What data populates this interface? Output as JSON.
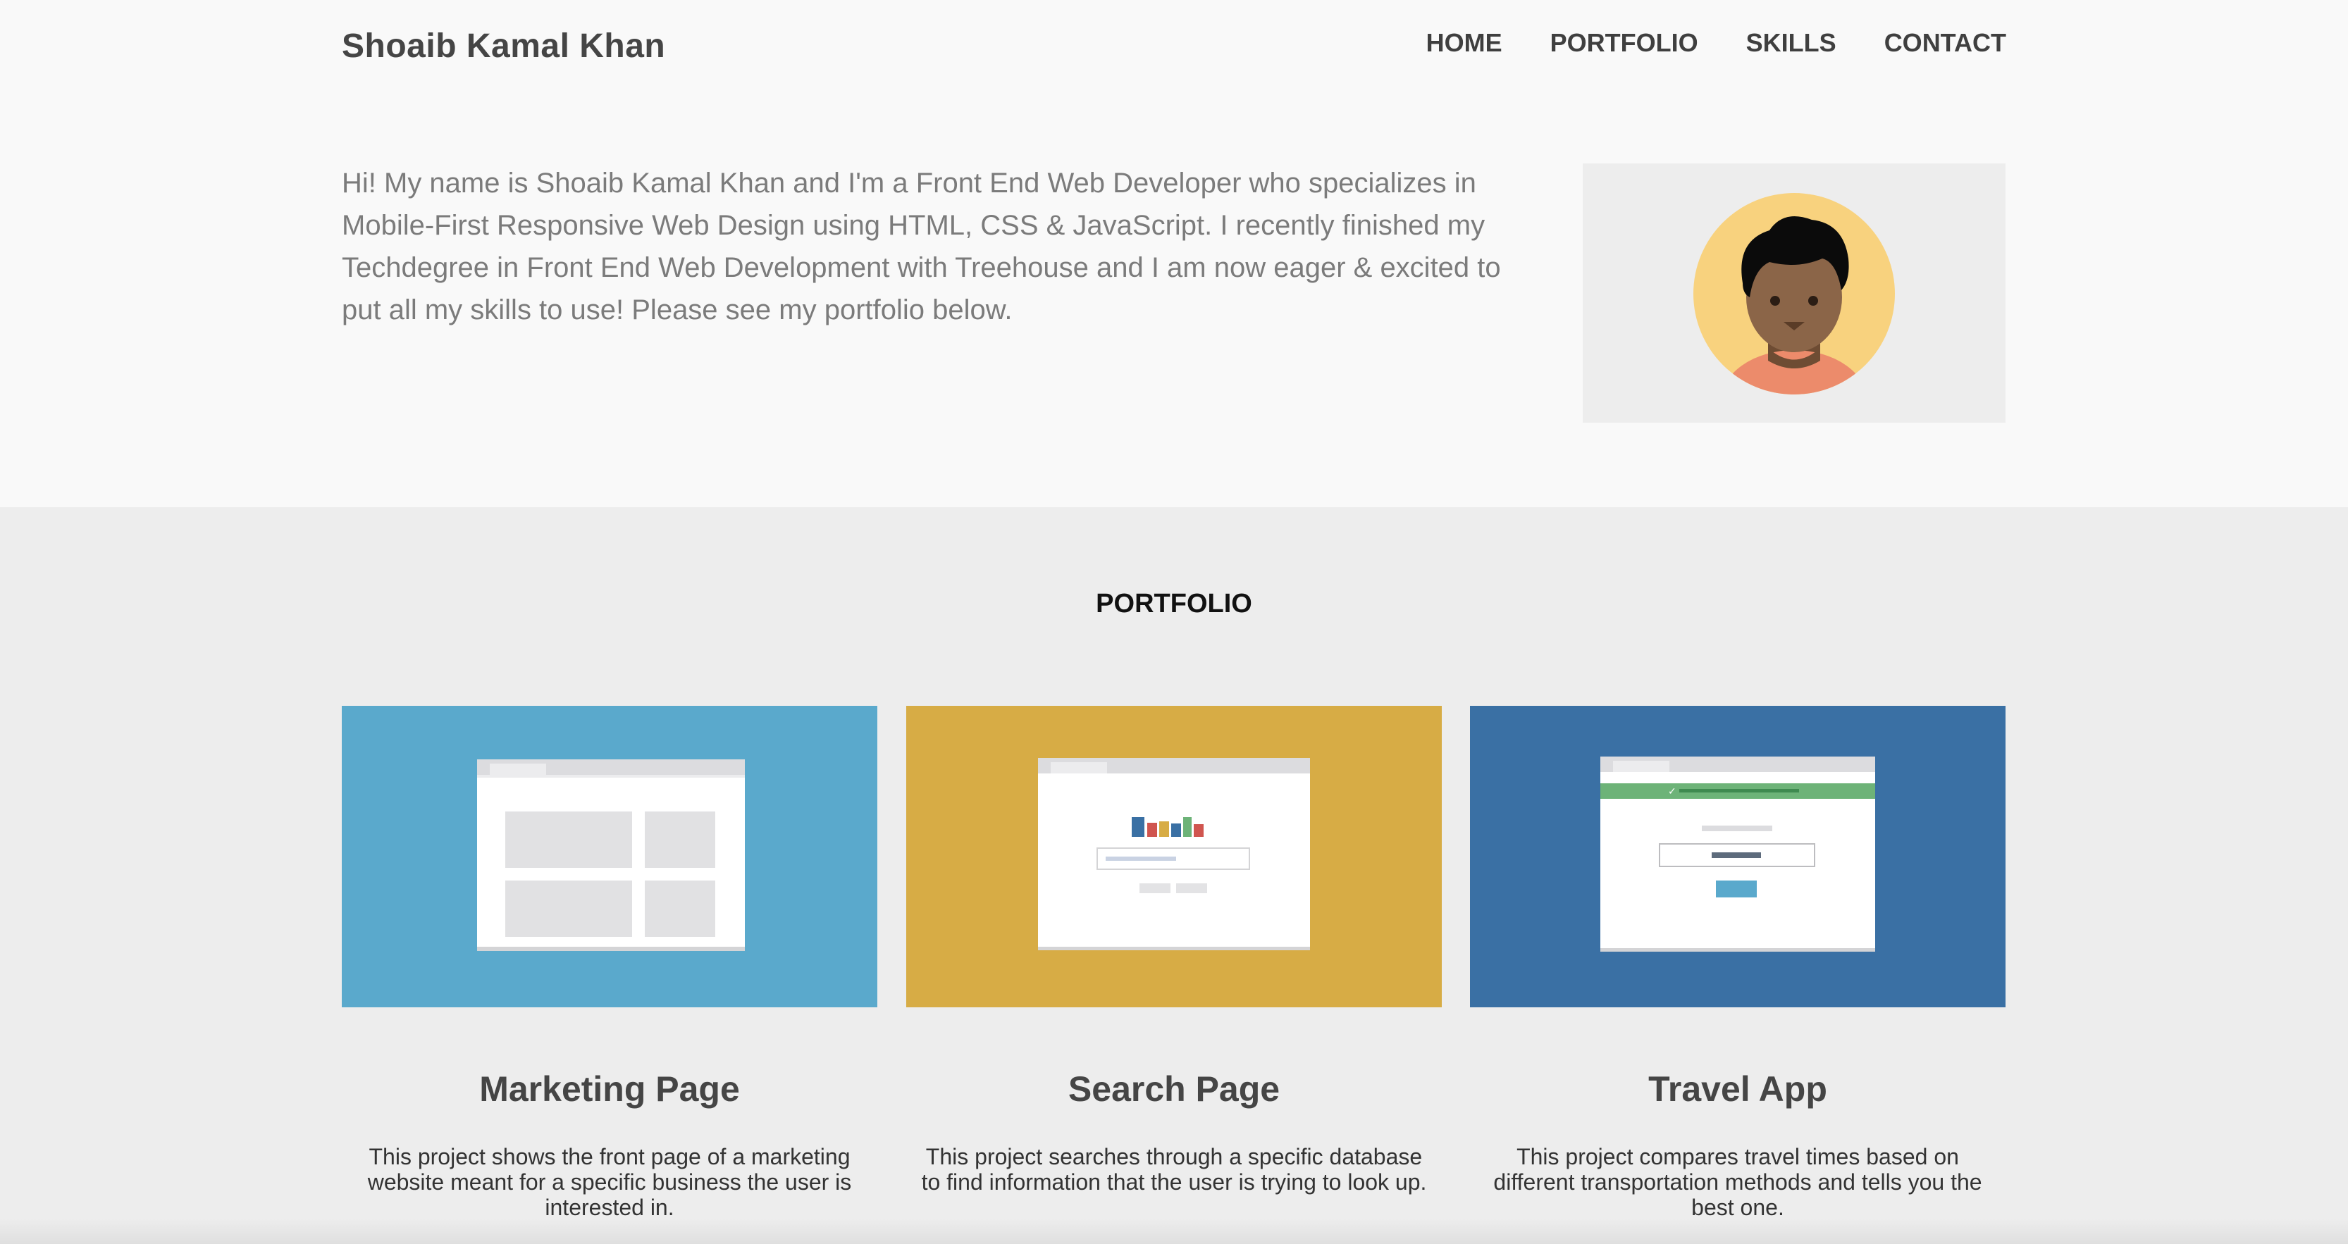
{
  "header": {
    "brand": "Shoaib Kamal Khan",
    "nav": [
      "HOME",
      "PORTFOLIO",
      "SKILLS",
      "CONTACT"
    ]
  },
  "intro": {
    "text": "Hi! My name is Shoaib Kamal Khan and I'm a Front End Web Developer who specializes in Mobile-First Responsive Web Design using HTML, CSS & JavaScript. I recently finished my Techdegree in Front End Web Development with Treehouse and I am now eager & excited to put all my skills to use! Please see my portfolio below."
  },
  "avatar": {
    "icon": "person-avatar-icon"
  },
  "portfolio": {
    "title": "PORTFOLIO",
    "projects": [
      {
        "title": "Marketing Page",
        "description": "This project shows the front page of a marketing website meant for a specific business the user is interested in.",
        "color": "#5aa9cc"
      },
      {
        "title": "Search Page",
        "description": "This project searches through a specific database to find information that the user is trying to look up.",
        "color": "#d7ac45"
      },
      {
        "title": "Travel App",
        "description": "This project compares travel times based on different transportation methods and tells you the best one.",
        "color": "#3a70a4"
      }
    ]
  }
}
